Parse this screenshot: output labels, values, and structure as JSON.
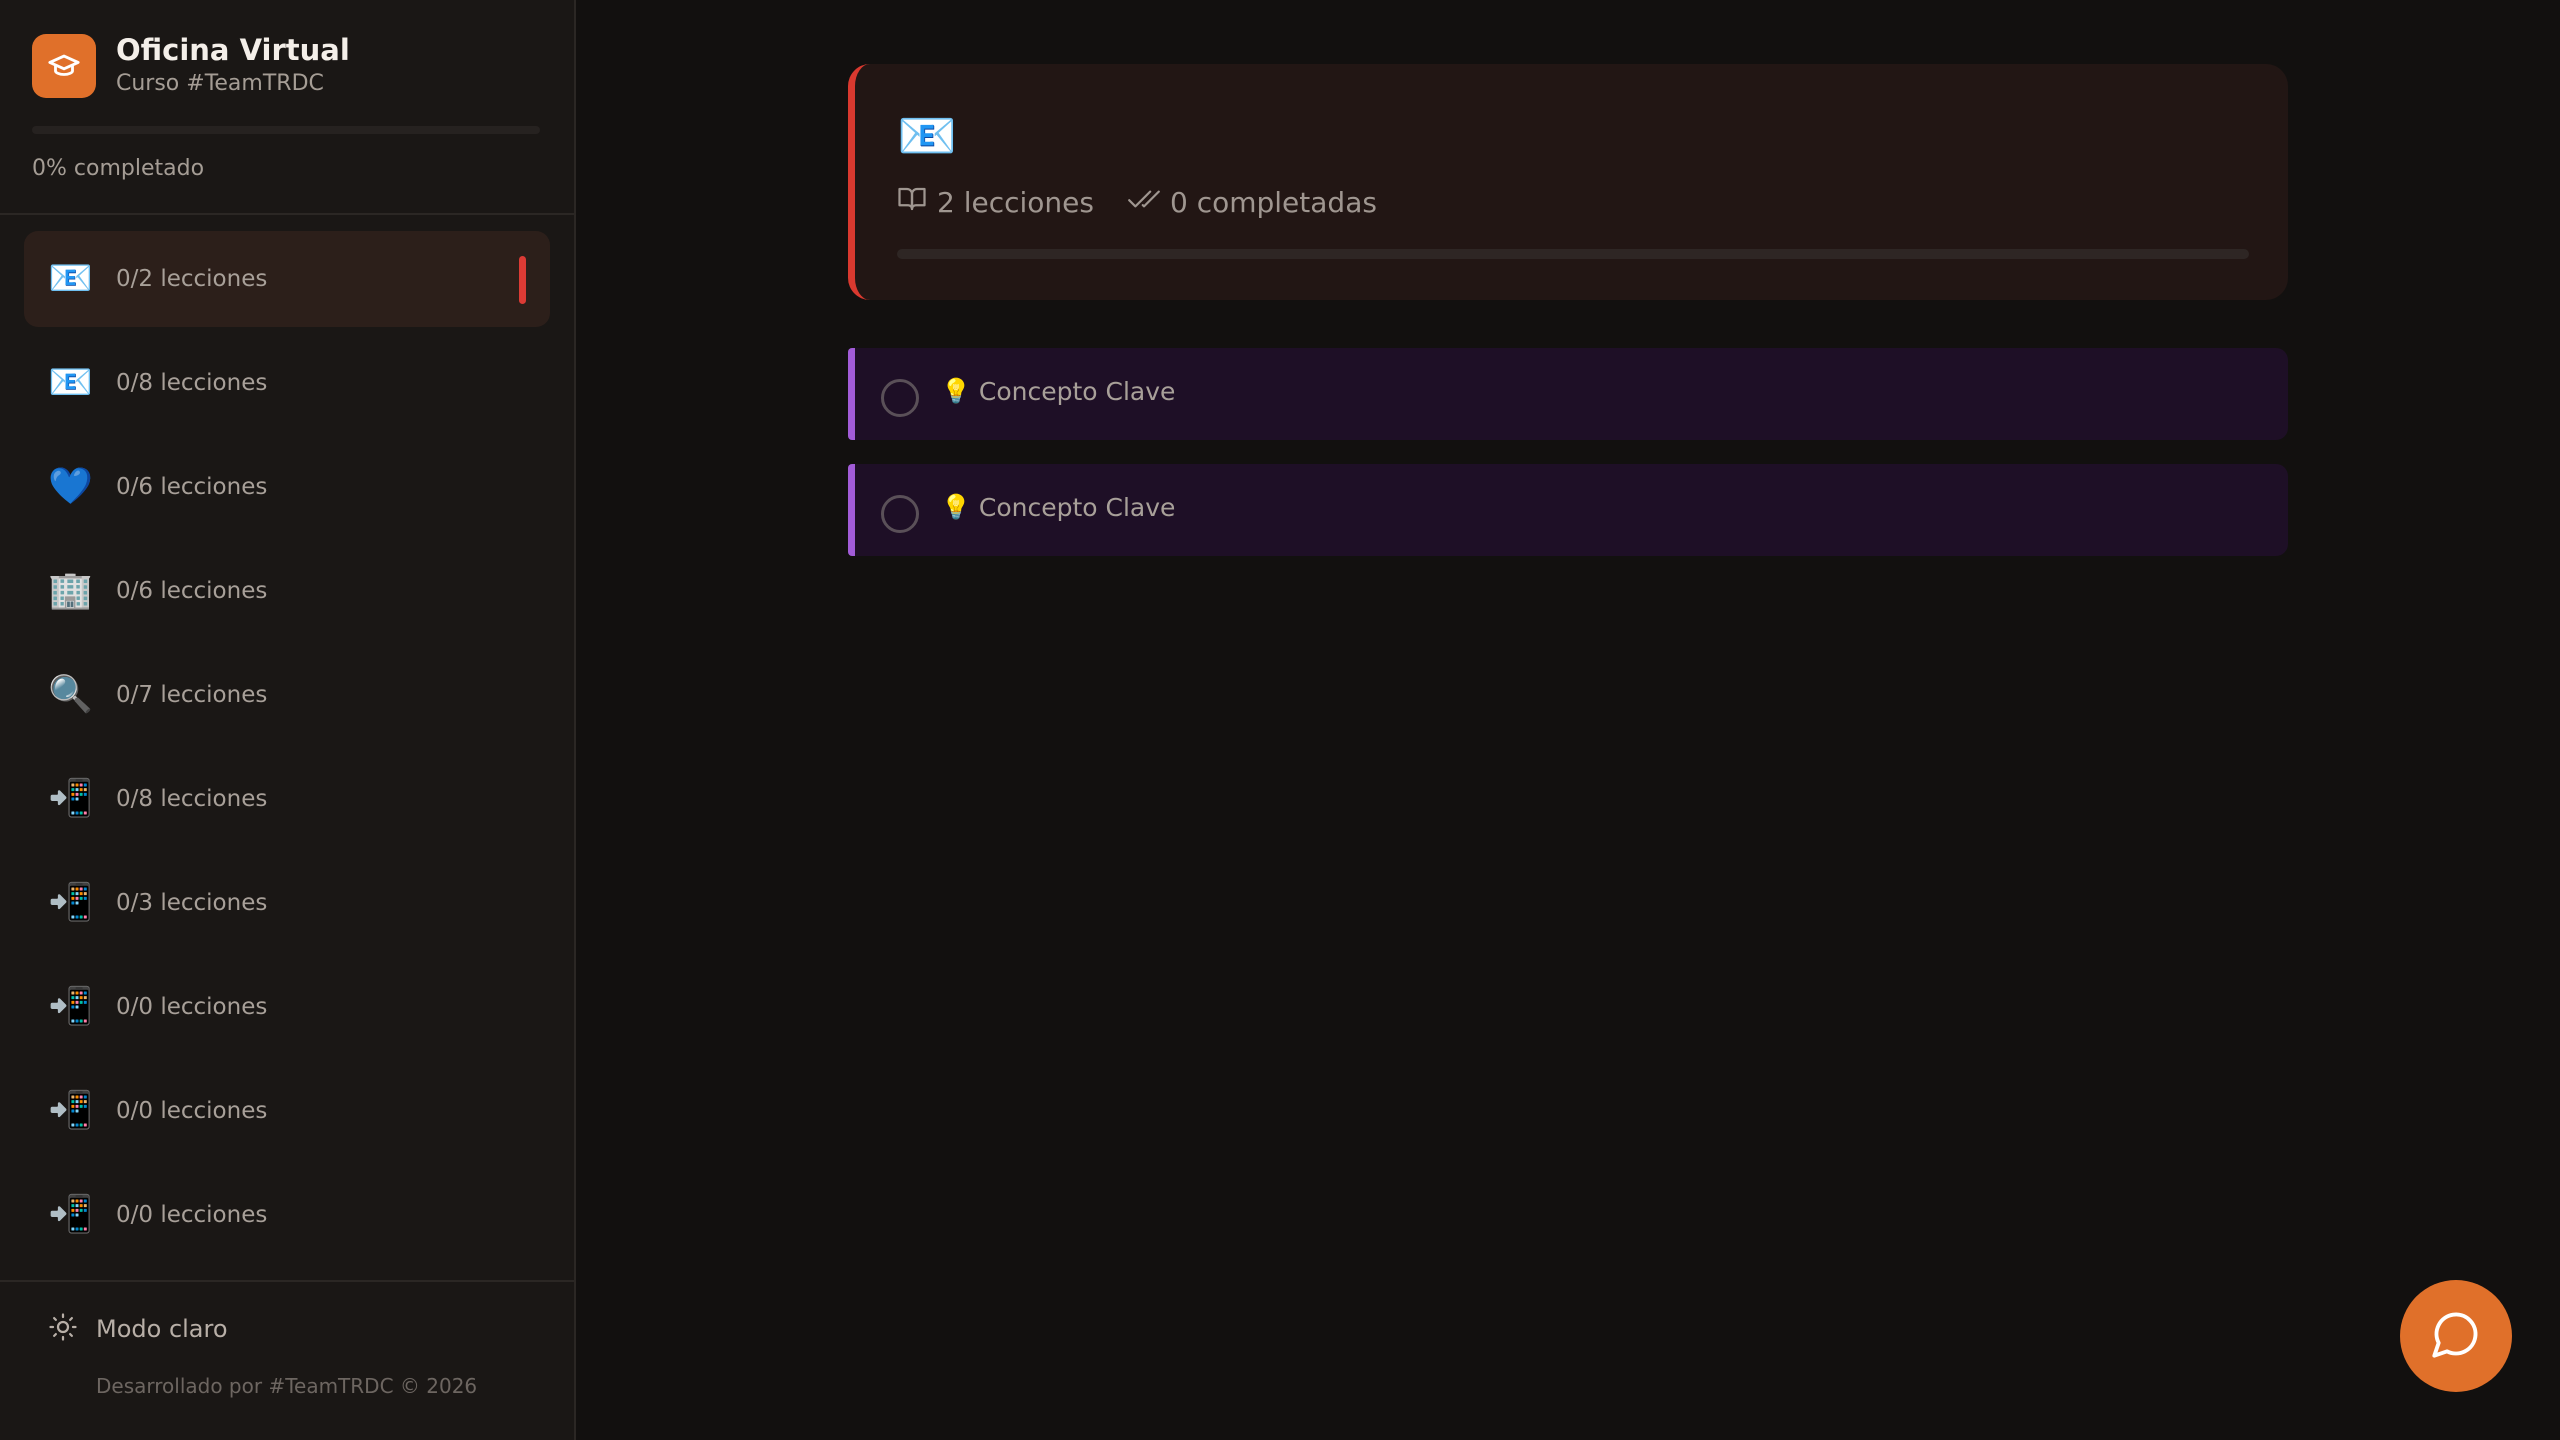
{
  "brand": {
    "title": "Oficina Virtual",
    "subtitle": "Curso #TeamTRDC",
    "progress_percent": 0,
    "progress_label": "0% completado",
    "accent_color": "#e0702a"
  },
  "modules": [
    {
      "icon": "📧",
      "icon_name": "email-icon",
      "label": "0/2 lecciones",
      "active": true
    },
    {
      "icon": "📧",
      "icon_name": "email-icon",
      "label": "0/8 lecciones"
    },
    {
      "icon": "💙",
      "icon_name": "blue-heart-icon",
      "label": "0/6 lecciones"
    },
    {
      "icon": "🏢",
      "icon_name": "office-building-icon",
      "label": "0/6 lecciones"
    },
    {
      "icon": "🔍",
      "icon_name": "magnifier-icon",
      "label": "0/7 lecciones"
    },
    {
      "icon": "📲",
      "icon_name": "mobile-arrow-icon",
      "label": "0/8 lecciones"
    },
    {
      "icon": "📲",
      "icon_name": "mobile-arrow-icon",
      "label": "0/3 lecciones"
    },
    {
      "icon": "📲",
      "icon_name": "mobile-arrow-icon",
      "label": "0/0 lecciones"
    },
    {
      "icon": "📲",
      "icon_name": "mobile-arrow-icon",
      "label": "0/0 lecciones"
    },
    {
      "icon": "📲",
      "icon_name": "mobile-arrow-icon",
      "label": "0/0 lecciones"
    }
  ],
  "footer": {
    "theme_toggle_label": "Modo claro",
    "credit": "Desarrollado por #TeamTRDC © 2026"
  },
  "hero": {
    "emoji": "📧",
    "lessons_count": "2 lecciones",
    "completed_count": "0 completadas",
    "progress_percent": 0,
    "accent_color": "#d9392f"
  },
  "lessons": [
    {
      "icon": "💡",
      "title": "Concepto Clave",
      "completed": false
    },
    {
      "icon": "💡",
      "title": "Concepto Clave",
      "completed": false
    }
  ]
}
